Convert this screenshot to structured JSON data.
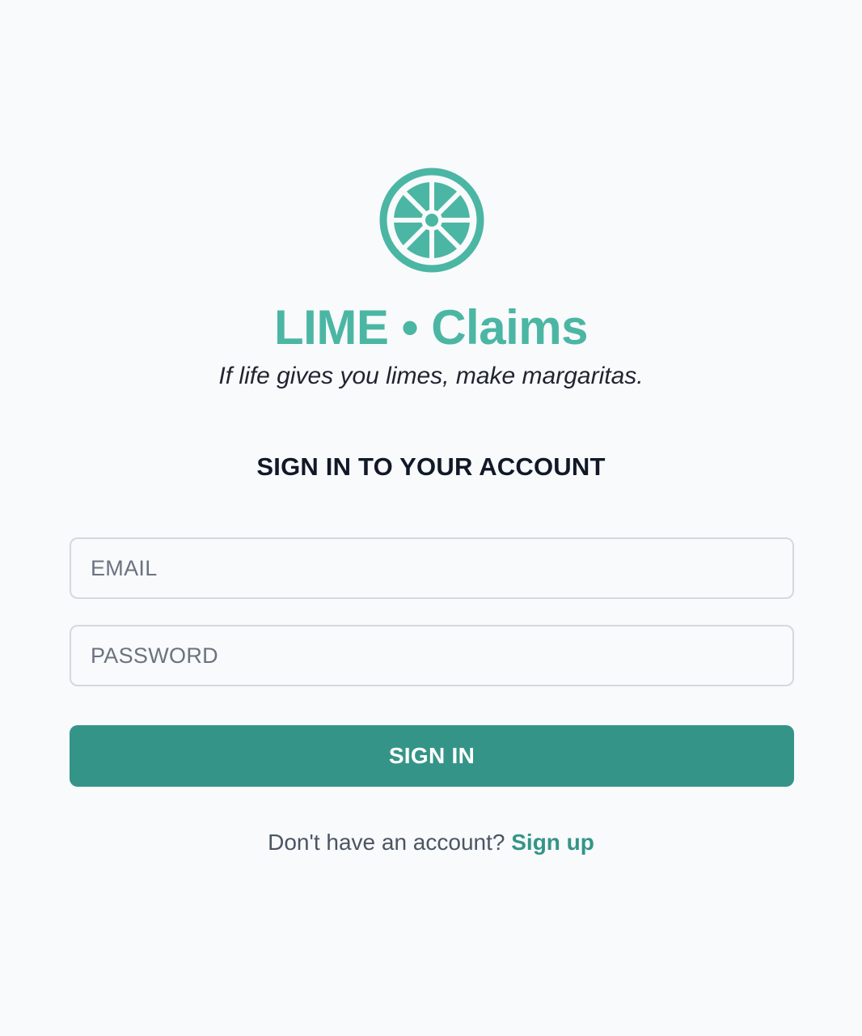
{
  "brand": {
    "logo_icon": "lime-slice-icon",
    "title": "LIME • Claims",
    "tagline": "If life gives you limes, make margaritas.",
    "accent_color": "#4bb6a3"
  },
  "form": {
    "heading": "SIGN IN TO YOUR ACCOUNT",
    "email": {
      "value": "",
      "placeholder": "EMAIL"
    },
    "password": {
      "value": "",
      "placeholder": "PASSWORD"
    },
    "submit_label": "SIGN IN",
    "button_color": "#359488"
  },
  "footer": {
    "prompt": "Don't have an account?",
    "signup_label": "Sign up"
  }
}
